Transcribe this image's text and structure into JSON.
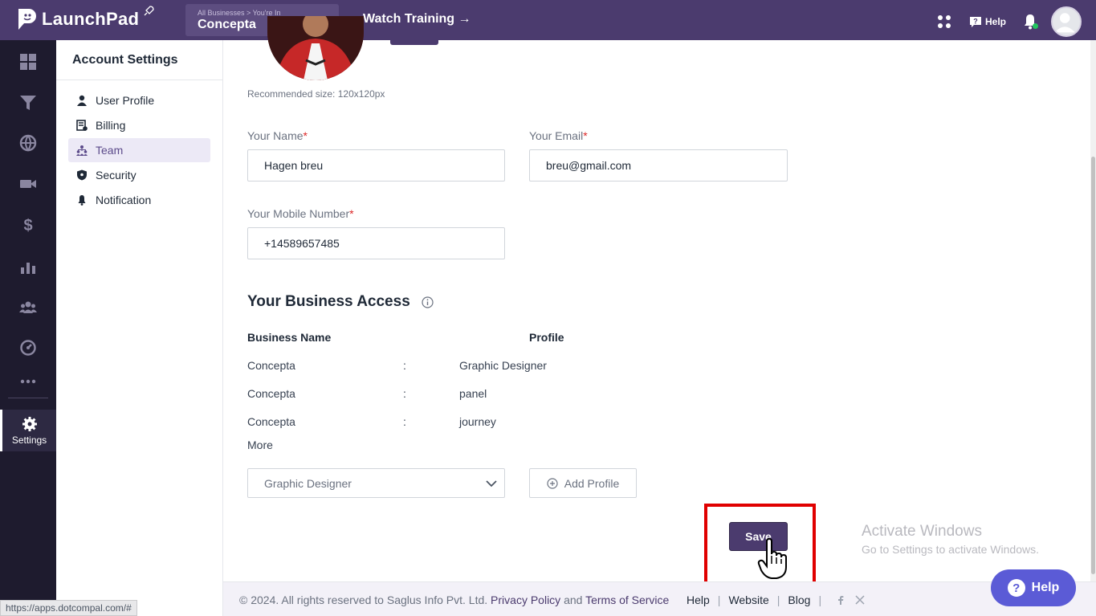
{
  "app": {
    "name": "LaunchPad"
  },
  "topbar": {
    "breadcrumb": "All Businesses > You're In",
    "business": "Concepta",
    "watch_training": "Watch Training →",
    "help": "Help"
  },
  "rail": {
    "settings_label": "Settings"
  },
  "settings_nav": {
    "title": "Account Settings",
    "items": [
      {
        "label": "User Profile",
        "icon": "user-icon"
      },
      {
        "label": "Billing",
        "icon": "billing-icon"
      },
      {
        "label": "Team",
        "icon": "team-icon",
        "active": true
      },
      {
        "label": "Security",
        "icon": "shield-icon"
      },
      {
        "label": "Notification",
        "icon": "bell-icon"
      }
    ]
  },
  "profile": {
    "recommended": "Recommended size: 120x120px",
    "name_label": "Your Name",
    "name_value": "Hagen breu",
    "email_label": "Your Email",
    "email_value": "breu@gmail.com",
    "mobile_label": "Your Mobile Number",
    "mobile_value": "+14589657485",
    "required_mark": "*"
  },
  "business_access": {
    "title": "Your Business Access",
    "col_business": "Business Name",
    "col_profile": "Profile",
    "separator": ":",
    "rows": [
      {
        "business": "Concepta",
        "profile": "Graphic Designer"
      },
      {
        "business": "Concepta",
        "profile": "panel"
      },
      {
        "business": "Concepta",
        "profile": "journey"
      }
    ],
    "more": "More",
    "select_value": "Graphic Designer",
    "add_profile": "Add Profile"
  },
  "save": "Save",
  "windows": {
    "title": "Activate Windows",
    "subtitle": "Go to Settings to activate Windows."
  },
  "footer": {
    "copyright": "©  2024. All rights reserved to Saglus Info Pvt. Ltd.",
    "privacy": "Privacy Policy",
    "and": "and",
    "terms": "Terms of Service",
    "help": "Help",
    "website": "Website",
    "blog": "Blog",
    "sep": "|"
  },
  "help_button": "Help",
  "help_q": "?",
  "status_url": "https://apps.dotcompal.com/#",
  "colors": {
    "brand": "#4b3b6e",
    "highlight": "#e00000",
    "help": "#5b5bd6"
  }
}
